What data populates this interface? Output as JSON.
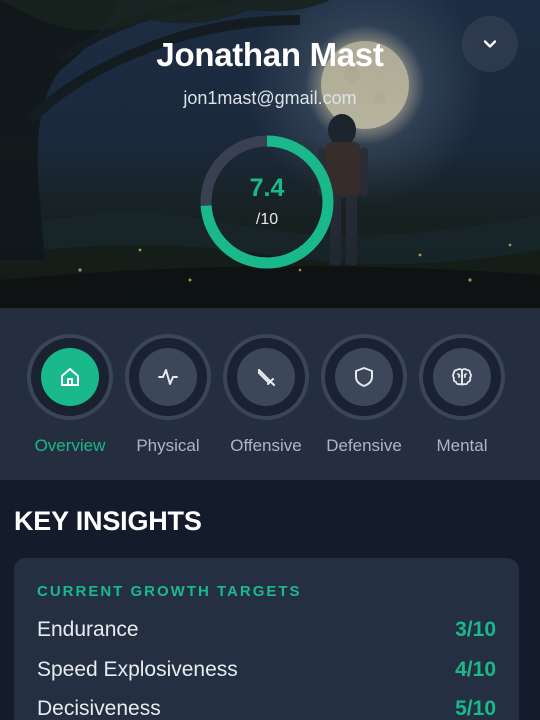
{
  "profile": {
    "name": "Jonathan Mast",
    "email": "jon1mast@gmail.com",
    "score": 7.4,
    "score_display": "7.4",
    "score_max_label": "/10"
  },
  "header": {
    "collapse_icon": "chevron-down-icon"
  },
  "categories": [
    {
      "label": "Overview",
      "icon": "home-icon",
      "active": true
    },
    {
      "label": "Physical",
      "icon": "activity-icon",
      "active": false
    },
    {
      "label": "Offensive",
      "icon": "sword-icon",
      "active": false
    },
    {
      "label": "Defensive",
      "icon": "shield-icon",
      "active": false
    },
    {
      "label": "Mental",
      "icon": "brain-icon",
      "active": false
    }
  ],
  "insights": {
    "title": "KEY INSIGHTS",
    "card_heading": "CURRENT GROWTH TARGETS",
    "targets": [
      {
        "label": "Endurance",
        "value": "3/10"
      },
      {
        "label": "Speed Explosiveness",
        "value": "4/10"
      },
      {
        "label": "Decisiveness",
        "value": "5/10"
      }
    ]
  },
  "colors": {
    "accent": "#19b98c",
    "background": "#141c2b",
    "nav_background": "#242e3e",
    "card_background": "#243042"
  }
}
